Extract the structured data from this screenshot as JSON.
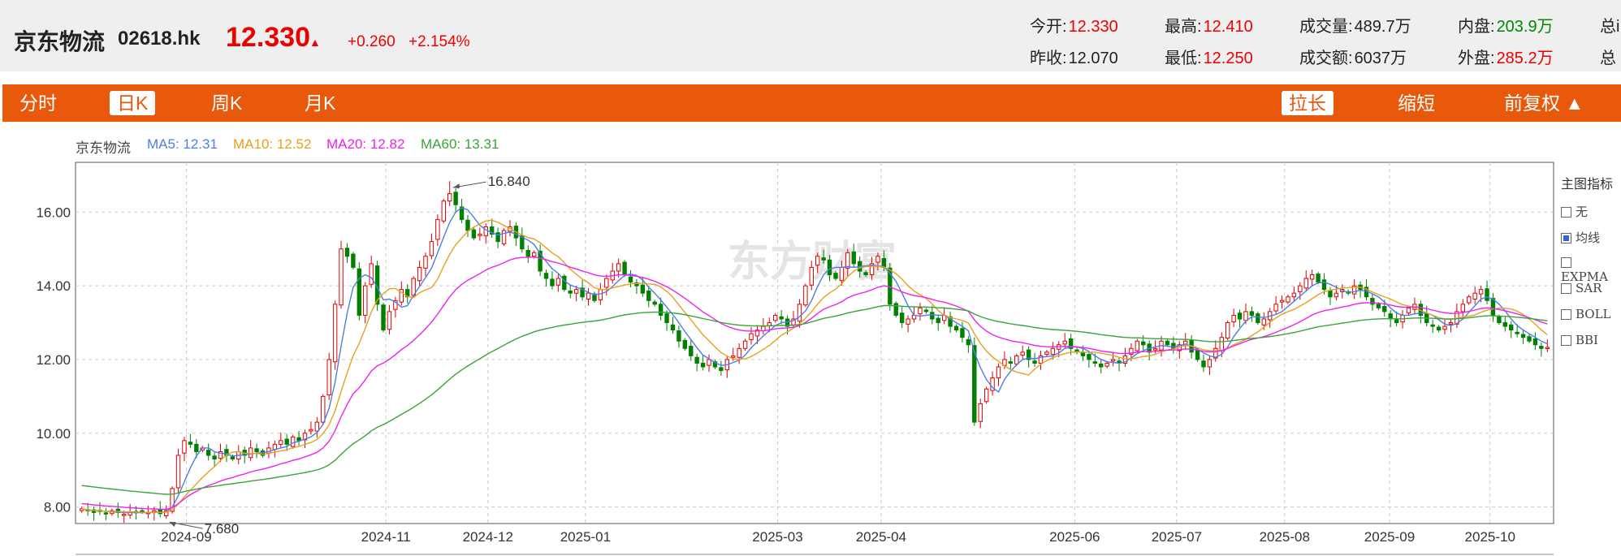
{
  "header": {
    "name": "京东物流",
    "code": "02618.hk",
    "price": "12.330",
    "arrow": "▲",
    "change": "+0.260",
    "change_pct": "+2.154%",
    "quotes": {
      "open_label": "今开:",
      "open": "12.330",
      "high_label": "最高:",
      "high": "12.410",
      "volume_label": "成交量:",
      "volume": "489.7万",
      "inner_label": "内盘:",
      "inner": "203.9万",
      "total_cut": "总i",
      "prev_label": "昨收:",
      "prev": "12.070",
      "low_label": "最低:",
      "low": "12.250",
      "amount_label": "成交额:",
      "amount": "6037万",
      "outer_label": "外盘:",
      "outer": "285.2万",
      "total_cut2": "总"
    }
  },
  "tabs": {
    "fenshi": "分时",
    "rik": "日K",
    "zhouk": "周K",
    "yuek": "月K",
    "lachang": "拉长",
    "suoduan": "缩短",
    "fuquan": "前复权 ▲"
  },
  "legend": {
    "name": "京东物流",
    "ma5": "MA5: 12.31",
    "ma10": "MA10: 12.52",
    "ma20": "MA20: 12.82",
    "ma60": "MA60: 13.31"
  },
  "indicators": {
    "title": "主图指标",
    "items": [
      {
        "label": "无",
        "checked": false
      },
      {
        "label": "均线",
        "checked": true
      },
      {
        "label": "EXPMA",
        "checked": false
      },
      {
        "label": "SAR",
        "checked": false
      },
      {
        "label": "BOLL",
        "checked": false
      },
      {
        "label": "BBI",
        "checked": false
      }
    ]
  },
  "watermark": "东方财富",
  "colors": {
    "up": "#e00000",
    "down": "#008000",
    "ma5": "#4a7ee8",
    "ma10": "#e8a020",
    "ma20": "#ee22ee",
    "ma60": "#3aa43a",
    "accent": "#e8590c"
  },
  "chart_data": {
    "type": "candlestick",
    "ylim": [
      7.55,
      17.35
    ],
    "yticks": [
      "8.00",
      "10.00",
      "12.00",
      "14.00",
      "16.00"
    ],
    "xticks": [
      "2024-09",
      "2024-11",
      "2024-12",
      "2025-01",
      "2025-03",
      "2025-04",
      "2025-06",
      "2025-07",
      "2025-08",
      "2025-09",
      "2025-10"
    ],
    "annotations": [
      {
        "label": "16.840",
        "value": 16.84
      },
      {
        "label": "7.680",
        "value": 7.68
      }
    ],
    "grid": true,
    "close": [
      7.95,
      7.9,
      7.85,
      7.88,
      7.82,
      7.9,
      7.85,
      7.8,
      7.86,
      7.84,
      7.87,
      7.85,
      7.9,
      7.82,
      7.9,
      8.5,
      9.4,
      9.8,
      9.7,
      9.5,
      9.6,
      9.4,
      9.3,
      9.5,
      9.4,
      9.3,
      9.5,
      9.4,
      9.6,
      9.5,
      9.4,
      9.6,
      9.7,
      9.8,
      9.7,
      9.9,
      9.8,
      10.0,
      10.1,
      10.3,
      11.0,
      12.0,
      13.5,
      15.0,
      14.8,
      14.5,
      13.2,
      14.0,
      14.6,
      13.5,
      12.8,
      13.3,
      13.6,
      13.9,
      13.7,
      14.2,
      14.5,
      14.8,
      15.2,
      15.8,
      16.3,
      16.5,
      16.2,
      15.8,
      15.5,
      15.3,
      15.4,
      15.6,
      15.4,
      15.2,
      15.5,
      15.6,
      15.3,
      15.0,
      14.8,
      14.9,
      14.4,
      14.2,
      14.0,
      14.2,
      13.9,
      13.8,
      13.9,
      13.7,
      13.8,
      13.6,
      13.9,
      14.2,
      14.4,
      14.6,
      14.3,
      14.1,
      14.0,
      13.8,
      13.6,
      13.5,
      13.2,
      13.0,
      12.8,
      12.5,
      12.3,
      12.1,
      11.9,
      11.8,
      12.0,
      11.8,
      11.7,
      12.0,
      12.1,
      12.3,
      12.5,
      12.7,
      12.8,
      12.9,
      13.0,
      13.2,
      13.1,
      12.9,
      13.1,
      13.5,
      14.0,
      14.5,
      14.8,
      14.7,
      14.3,
      14.2,
      14.5,
      14.9,
      14.6,
      14.4,
      14.3,
      14.6,
      14.8,
      14.5,
      13.5,
      13.2,
      13.0,
      13.1,
      13.2,
      13.4,
      13.3,
      13.1,
      13.0,
      13.2,
      12.9,
      12.8,
      12.6,
      12.4,
      10.3,
      10.8,
      11.2,
      11.5,
      11.8,
      12.0,
      11.9,
      12.1,
      12.2,
      12.0,
      11.9,
      12.1,
      12.2,
      12.3,
      12.4,
      12.5,
      12.3,
      12.2,
      12.1,
      12.0,
      11.9,
      11.8,
      11.9,
      12.0,
      11.9,
      12.1,
      12.3,
      12.5,
      12.4,
      12.2,
      12.3,
      12.5,
      12.4,
      12.3,
      12.4,
      12.5,
      12.2,
      12.0,
      11.8,
      12.0,
      12.3,
      12.6,
      13.0,
      13.2,
      13.1,
      13.3,
      13.2,
      13.0,
      13.1,
      13.3,
      13.5,
      13.6,
      13.7,
      13.8,
      14.0,
      14.2,
      14.3,
      14.1,
      13.9,
      13.7,
      13.8,
      13.9,
      13.8,
      14.0,
      13.9,
      13.7,
      13.5,
      13.4,
      13.3,
      13.1,
      13.0,
      13.2,
      13.4,
      13.5,
      13.2,
      13.0,
      12.9,
      12.8,
      12.9,
      13.0,
      13.3,
      13.5,
      13.7,
      13.8,
      13.9,
      13.6,
      13.2,
      13.0,
      12.9,
      12.8,
      12.7,
      12.6,
      12.5,
      12.4,
      12.3,
      12.33
    ],
    "ma5_last": 12.31,
    "ma10_last": 12.52,
    "ma20_last": 12.82,
    "ma60_last": 13.31
  }
}
